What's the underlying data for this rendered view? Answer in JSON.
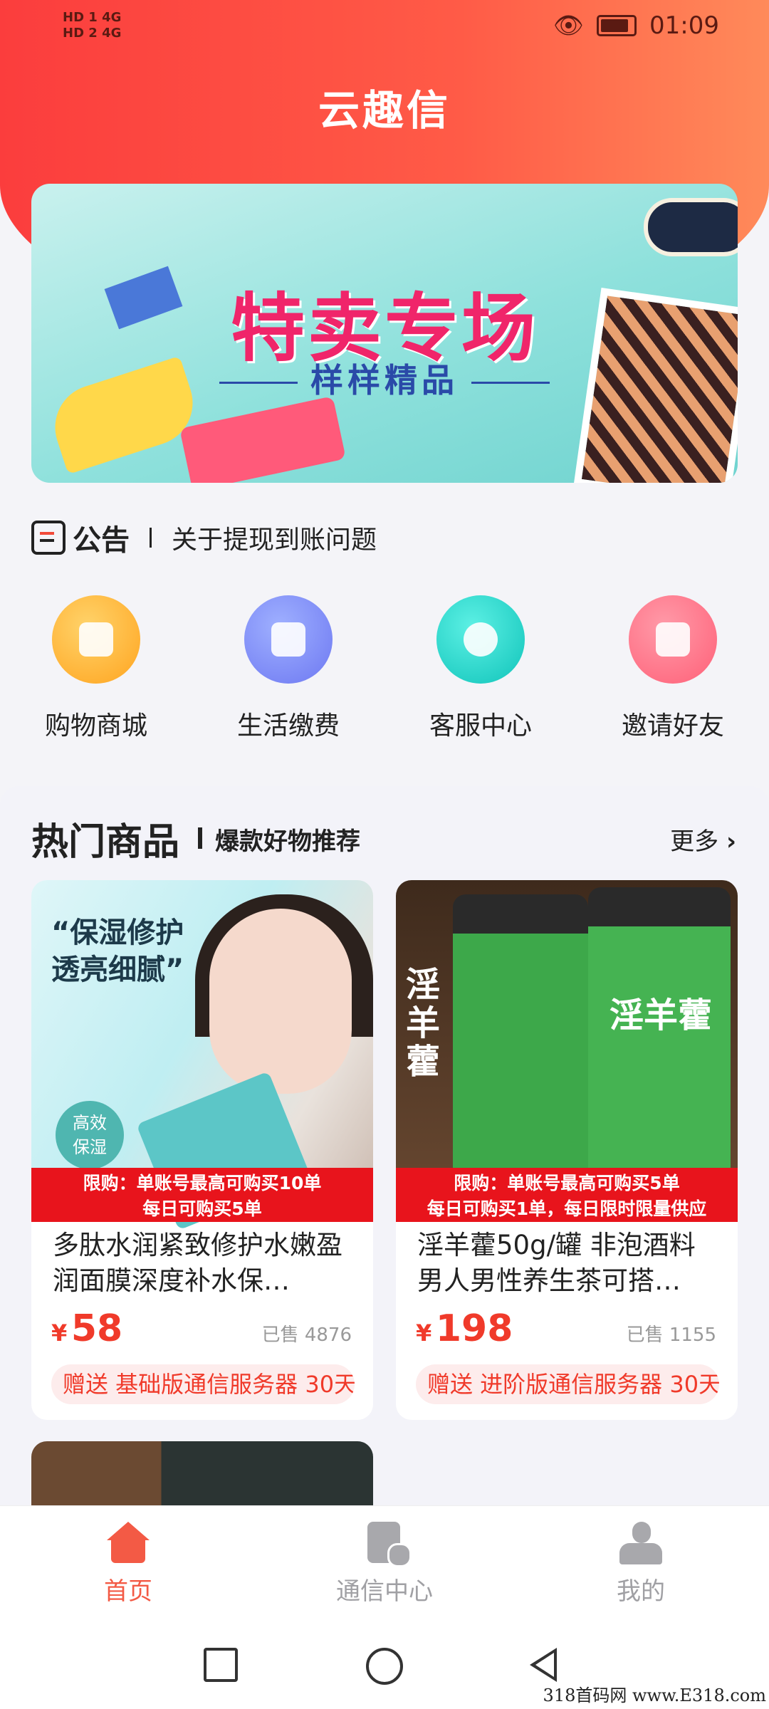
{
  "status_bar": {
    "left_top": "HD 1 4G",
    "left_bottom": "HD 2 4G",
    "time": "01:09"
  },
  "app_title": "云趣信",
  "banner": {
    "title": "特卖专场",
    "subtitle": "样样精品"
  },
  "notice": {
    "label": "公告",
    "text": "关于提现到账问题"
  },
  "quick_actions": [
    {
      "label": "购物商城",
      "color": "#ffb433",
      "icon": "shopping-bag-icon"
    },
    {
      "label": "生活缴费",
      "color": "#7f8cf8",
      "icon": "phone-bill-icon"
    },
    {
      "label": "客服中心",
      "color": "#1fd1c8",
      "icon": "headset-icon"
    },
    {
      "label": "邀请好友",
      "color": "#ff7387",
      "icon": "invite-mail-icon"
    }
  ],
  "hot_section": {
    "title": "热门商品",
    "subtitle": "爆款好物推荐",
    "more": "更多",
    "more_chevron": "›"
  },
  "products": [
    {
      "image_text": "“保湿修护\n透亮细腻”",
      "image_badge": "高效\n保湿",
      "limit_line1": "限购：单账号最高可购买10单",
      "limit_line2": "每日可购买5单",
      "name": "多肽水润紧致修护水嫩盈润面膜深度补水保…",
      "price_symbol": "¥",
      "price": "58",
      "sold": "已售 4876",
      "gift": "赠送 基础版通信服务器 30天"
    },
    {
      "image_text": "淫羊藿",
      "limit_line1": "限购：单账号最高可购买5单",
      "limit_line2": "每日可购买1单，每日限时限量供应",
      "name": "淫羊藿50g/罐 非泡酒料男人男性养生茶可搭…",
      "price_symbol": "¥",
      "price": "198",
      "sold": "已售 1155",
      "gift": "赠送 进阶版通信服务器 30天"
    }
  ],
  "tabs": [
    {
      "label": "首页",
      "active": true,
      "color": "#f35a45"
    },
    {
      "label": "通信中心",
      "active": false,
      "color": "#a0a0a4"
    },
    {
      "label": "我的",
      "active": false,
      "color": "#a0a0a4"
    }
  ],
  "watermark": "318首码网 www.E318.com",
  "colors": {
    "header_gradient_start": "#fb3d3d",
    "header_gradient_end": "#ff8a5a",
    "accent": "#f03a2a",
    "limit_bar": "#e8141c"
  }
}
